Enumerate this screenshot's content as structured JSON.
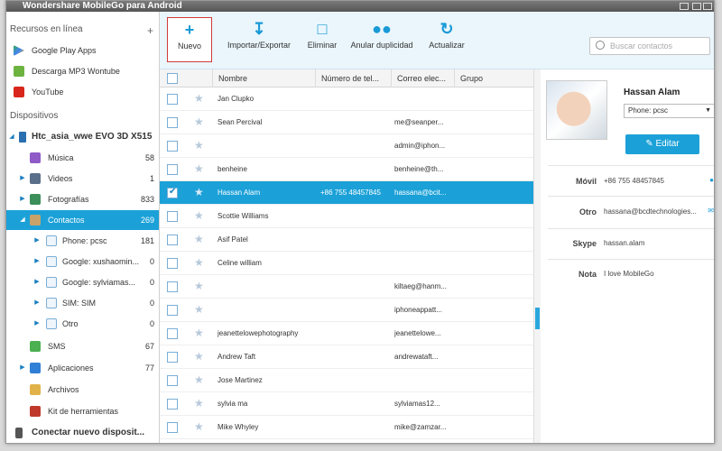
{
  "window": {
    "title": "Wondershare MobileGo para Android"
  },
  "sidebar": {
    "resources_header": "Recursos en línea",
    "add_label": "+",
    "resources": [
      {
        "label": "Google Play Apps",
        "icon": "google-play-icon"
      },
      {
        "label": "Descarga MP3 Wontube",
        "icon": "music-download-icon"
      },
      {
        "label": "YouTube",
        "icon": "youtube-icon"
      }
    ],
    "devices_header": "Dispositivos",
    "device": {
      "label": "Htc_asia_wwe EVO 3D X515",
      "icon": "phone-icon"
    },
    "items": [
      {
        "label": "Música",
        "count": "58",
        "icon": "music-icon"
      },
      {
        "label": "Videos",
        "count": "1",
        "icon": "video-icon"
      },
      {
        "label": "Fotografías",
        "count": "833",
        "icon": "photo-icon"
      },
      {
        "label": "Contactos",
        "count": "269",
        "icon": "contacts-icon",
        "selected": true
      },
      {
        "label": "Phone: pcsc",
        "count": "181",
        "icon": "contact-group-icon"
      },
      {
        "label": "Google: xushaomin...",
        "count": "0",
        "icon": "contact-group-icon"
      },
      {
        "label": "Google: sylviamas...",
        "count": "0",
        "icon": "contact-group-icon"
      },
      {
        "label": "SIM: SIM",
        "count": "0",
        "icon": "contact-group-icon"
      },
      {
        "label": "Otro",
        "count": "0",
        "icon": "contact-group-icon"
      },
      {
        "label": "SMS",
        "count": "67",
        "icon": "sms-icon"
      },
      {
        "label": "Aplicaciones",
        "count": "77",
        "icon": "apps-icon"
      },
      {
        "label": "Archivos",
        "count": "",
        "icon": "folder-icon"
      },
      {
        "label": "Kit de herramientas",
        "count": "",
        "icon": "toolkit-icon"
      }
    ],
    "connect_label": "Conectar nuevo disposit..."
  },
  "toolbar": {
    "buttons": [
      {
        "label": "Nuevo",
        "icon": "plus-icon"
      },
      {
        "label": "Importar/Exportar",
        "icon": "import-export-icon"
      },
      {
        "label": "Eliminar",
        "icon": "trash-icon"
      },
      {
        "label": "Anular duplicidad",
        "icon": "merge-duplicates-icon"
      },
      {
        "label": "Actualizar",
        "icon": "refresh-icon"
      }
    ],
    "search_placeholder": "Buscar contactos"
  },
  "table": {
    "columns": [
      "Nombre",
      "Número de tel...",
      "Correo elec...",
      "Grupo"
    ],
    "rows": [
      {
        "name": "Jan Clupko",
        "phone": "",
        "email": "",
        "group": ""
      },
      {
        "name": "Sean Percival",
        "phone": "",
        "email": "me@seanper...",
        "group": ""
      },
      {
        "name": "",
        "phone": "",
        "email": "admin@iphon...",
        "group": ""
      },
      {
        "name": "benheine",
        "phone": "",
        "email": "benheine@th...",
        "group": ""
      },
      {
        "name": "Hassan Alam",
        "phone": "+86 755 48457845",
        "email": "hassana@bcit...",
        "group": "",
        "selected": true
      },
      {
        "name": "Scottie Williams",
        "phone": "",
        "email": "",
        "group": ""
      },
      {
        "name": "Asif Patel",
        "phone": "",
        "email": "",
        "group": ""
      },
      {
        "name": "Celine william",
        "phone": "",
        "email": "",
        "group": ""
      },
      {
        "name": "",
        "phone": "",
        "email": "kiltaeg@hanm...",
        "group": ""
      },
      {
        "name": "",
        "phone": "",
        "email": "iphoneappatt...",
        "group": ""
      },
      {
        "name": "jeanettelowephotography",
        "phone": "",
        "email": "jeanettelowe...",
        "group": ""
      },
      {
        "name": "Andrew Taft",
        "phone": "",
        "email": "andrewataft...",
        "group": ""
      },
      {
        "name": "Jose Martinez",
        "phone": "",
        "email": "",
        "group": ""
      },
      {
        "name": "sylvia ma",
        "phone": "",
        "email": "sylviamas12...",
        "group": ""
      },
      {
        "name": "Mike Whyley",
        "phone": "",
        "email": "mike@zamzar...",
        "group": ""
      }
    ]
  },
  "detail": {
    "name": "Hassan Alam",
    "account": "Phone: pcsc",
    "edit_label": "Editar",
    "fields": [
      {
        "label": "Móvil",
        "value": "+86 755 48457845",
        "icon": "chat-icon"
      },
      {
        "label": "Otro",
        "value": "hassana@bcdtechnologies...",
        "icon": "email-icon"
      },
      {
        "label": "Skype",
        "value": "hassan.alam",
        "icon": ""
      },
      {
        "label": "Nota",
        "value": "I love MobileGo",
        "icon": ""
      }
    ]
  },
  "colors": {
    "accent": "#1ba1d8",
    "toolbar_bg": "#eaf6fc",
    "highlight_border": "#d23a3a"
  }
}
